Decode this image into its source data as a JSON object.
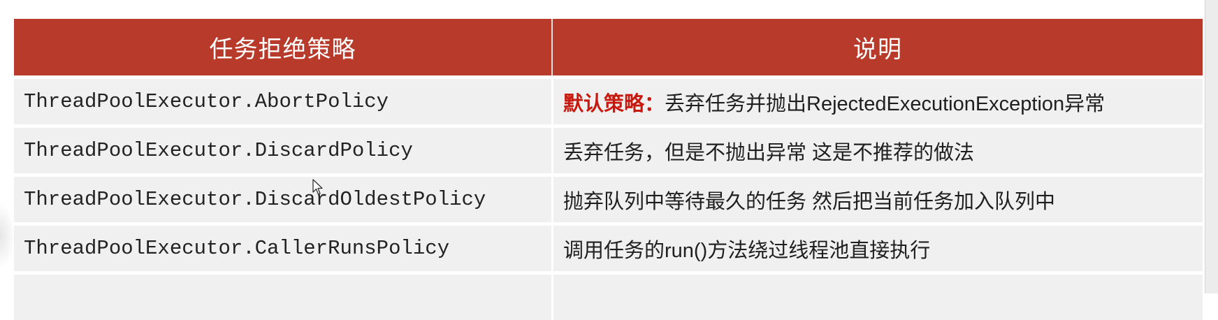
{
  "colors": {
    "header_bg": "#B83A2A",
    "row_bg": "#F0F0F0",
    "highlight": "#C8190F"
  },
  "table": {
    "headers": [
      "任务拒绝策略",
      "说明"
    ],
    "rows": [
      {
        "policy": "ThreadPoolExecutor.AbortPolicy",
        "highlight": "默认策略：",
        "description": "丢弃任务并抛出RejectedExecutionException异常"
      },
      {
        "policy": "ThreadPoolExecutor.DiscardPolicy",
        "highlight": "",
        "description": "丢弃任务，但是不抛出异常 这是不推荐的做法"
      },
      {
        "policy": "ThreadPoolExecutor.DiscardOldestPolicy",
        "highlight": "",
        "description": "抛弃队列中等待最久的任务 然后把当前任务加入队列中"
      },
      {
        "policy": "ThreadPoolExecutor.CallerRunsPolicy",
        "highlight": "",
        "description": "调用任务的run()方法绕过线程池直接执行"
      }
    ]
  }
}
